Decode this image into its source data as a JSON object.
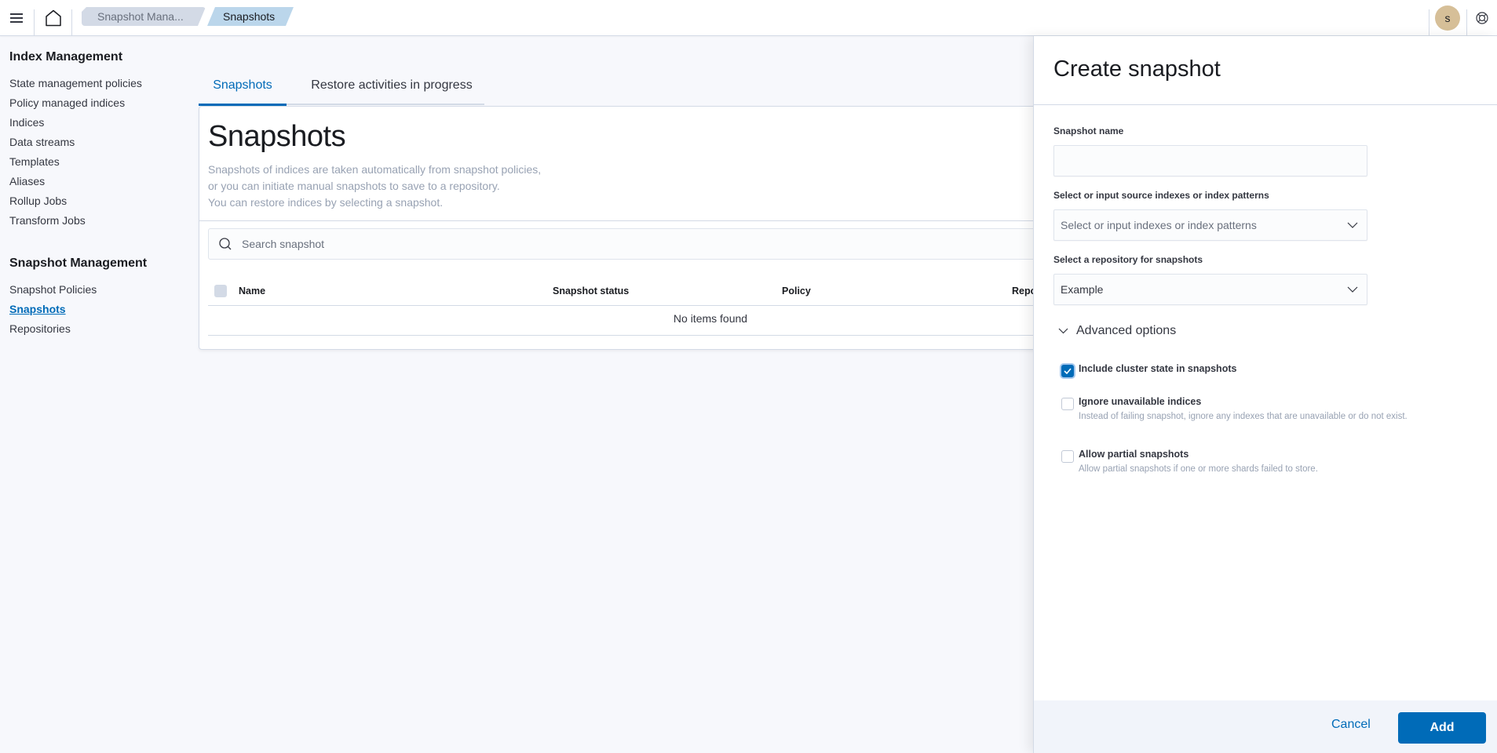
{
  "header": {
    "menu_icon": "hamburger-menu-icon",
    "home_icon": "home-icon",
    "breadcrumbs": [
      {
        "label": "Snapshot Mana..."
      },
      {
        "label": "Snapshots"
      }
    ],
    "avatar_initial": "s",
    "help_icon": "help-lifebuoy-icon"
  },
  "sidebar": {
    "sections": [
      {
        "title": "Index Management",
        "items": [
          {
            "label": "State management policies"
          },
          {
            "label": "Policy managed indices"
          },
          {
            "label": "Indices"
          },
          {
            "label": "Data streams"
          },
          {
            "label": "Templates"
          },
          {
            "label": "Aliases"
          },
          {
            "label": "Rollup Jobs"
          },
          {
            "label": "Transform Jobs"
          }
        ]
      },
      {
        "title": "Snapshot Management",
        "items": [
          {
            "label": "Snapshot Policies"
          },
          {
            "label": "Snapshots",
            "active": true
          },
          {
            "label": "Repositories"
          }
        ]
      }
    ]
  },
  "main": {
    "tabs": [
      {
        "label": "Snapshots",
        "selected": true
      },
      {
        "label": "Restore activities in progress",
        "selected": false
      }
    ],
    "title": "Snapshots",
    "description": [
      "Snapshots of indices are taken automatically from snapshot policies,",
      "or you can initiate manual snapshots to save to a repository.",
      "You can restore indices by selecting a snapshot."
    ],
    "search": {
      "placeholder": "Search snapshot",
      "value": ""
    },
    "table": {
      "columns": [
        "Name",
        "Snapshot status",
        "Policy",
        "Repo"
      ],
      "rows": [],
      "empty_message": "No items found"
    }
  },
  "flyout": {
    "title": "Create snapshot",
    "fields": {
      "snapshot_name": {
        "label": "Snapshot name",
        "value": ""
      },
      "source_indexes": {
        "label": "Select or input source indexes or index patterns",
        "placeholder": "Select or input indexes or index patterns"
      },
      "repository": {
        "label": "Select a repository for snapshots",
        "value": "Example"
      }
    },
    "advanced": {
      "label": "Advanced options",
      "expanded": true,
      "options": [
        {
          "label": "Include cluster state in snapshots",
          "help": "",
          "checked": true
        },
        {
          "label": "Ignore unavailable indices",
          "help": "Instead of failing snapshot, ignore any indexes that are unavailable or do not exist.",
          "checked": false
        },
        {
          "label": "Allow partial snapshots",
          "help": "Allow partial snapshots if one or more shards failed to store.",
          "checked": false
        }
      ]
    },
    "footer": {
      "cancel_label": "Cancel",
      "add_label": "Add"
    }
  },
  "colors": {
    "accent": "#006bb8",
    "breadcrumb_active": "#bbd6eb",
    "avatar": "#d6bf98",
    "page_bg": "#f7f8fc"
  }
}
